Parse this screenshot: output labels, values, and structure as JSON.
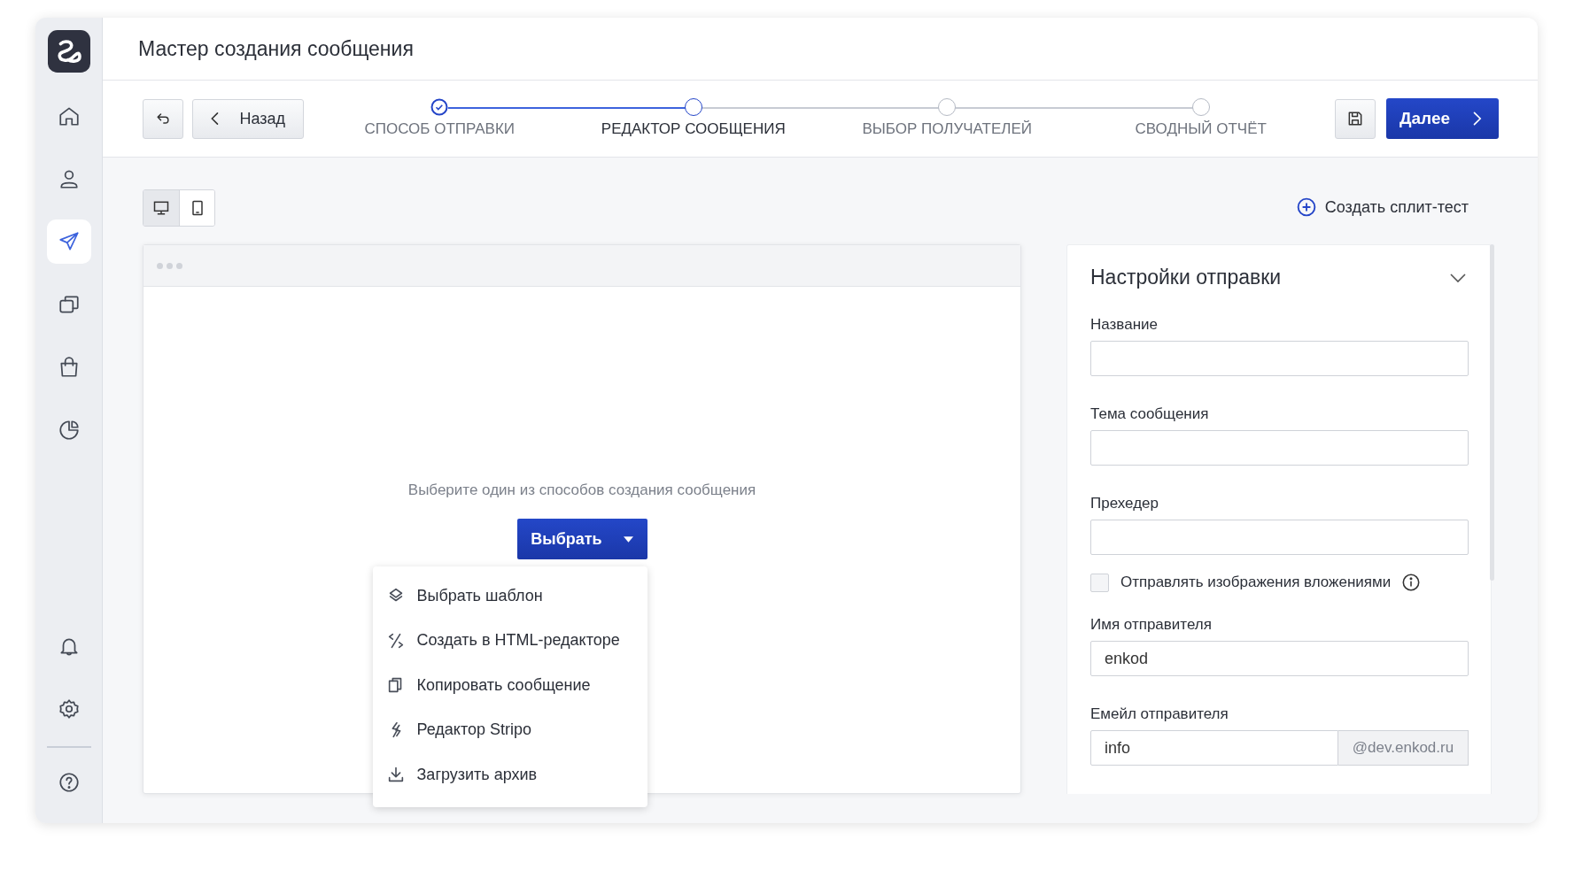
{
  "header": {
    "title": "Мастер создания сообщения"
  },
  "sidebar": {
    "nav_items": [
      {
        "selected": false
      },
      {
        "selected": false
      },
      {
        "selected": true
      },
      {
        "selected": false
      },
      {
        "selected": false
      },
      {
        "selected": false
      }
    ],
    "bottom_items": [
      {
        "selected": false
      },
      {
        "selected": false
      }
    ],
    "help_item": {
      "selected": false
    }
  },
  "toolbar": {
    "back_button": "Назад",
    "next_button": "Далее",
    "steps": [
      {
        "label": "СПОСОБ ОТПРАВКИ",
        "done": true,
        "selected": false
      },
      {
        "label": "РЕДАКТОР СООБЩЕНИЯ",
        "done": false,
        "selected": true
      },
      {
        "label": "ВЫБОР ПОЛУЧАТЕЛЕЙ",
        "done": false,
        "selected": false
      },
      {
        "label": "СВОДНЫЙ ОТЧЁТ",
        "done": false,
        "selected": false
      }
    ]
  },
  "view_toggle": [
    {
      "selected": true
    },
    {
      "selected": false
    }
  ],
  "split_test_link": "Создать сплит-тест",
  "editor": {
    "prompt": "Выберите один из способов создания сообщения",
    "choose_button": "Выбрать",
    "menu": [
      {
        "label": "Выбрать шаблон"
      },
      {
        "label": "Создать в HTML-редакторе"
      },
      {
        "label": "Копировать сообщение"
      },
      {
        "label": "Редактор Stripo"
      },
      {
        "label": "Загрузить архив"
      }
    ]
  },
  "settings": {
    "title": "Настройки отправки",
    "expanded": true,
    "fields": [
      {
        "kind": "text",
        "label": "Название"
      },
      {
        "kind": "text",
        "label": "Тема сообщения"
      },
      {
        "kind": "text",
        "label": "Прехедер"
      },
      {
        "kind": "checkbox",
        "label": "Отправлять изображения вложениями",
        "checked": false
      },
      {
        "kind": "text",
        "label": "Имя отправителя",
        "value": "enkod"
      },
      {
        "kind": "suffix",
        "label": "Емейл отправителя",
        "value": "info",
        "suffix": "@dev.enkod.ru"
      }
    ]
  }
}
